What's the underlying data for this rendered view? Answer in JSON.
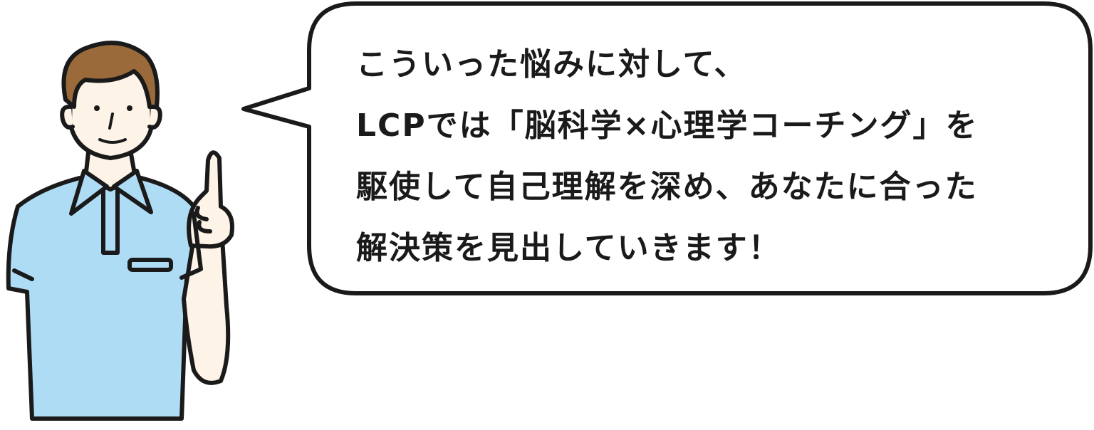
{
  "speech": {
    "lines": [
      "こういった悩みに対して、",
      "LCPでは「脳科学×心理学コーチング」を",
      "駆使して自己理解を深め、あなたに合った",
      "解決策を見出していきます！"
    ]
  },
  "colors": {
    "outline": "#1a1a1a",
    "shirt": "#aedcf5",
    "skin": "#fdf3e6",
    "hair": "#9a6a3a",
    "bubble_fill": "#ffffff"
  },
  "icons": {
    "character": "man-pointing-up-illustration",
    "bubble": "speech-bubble"
  }
}
